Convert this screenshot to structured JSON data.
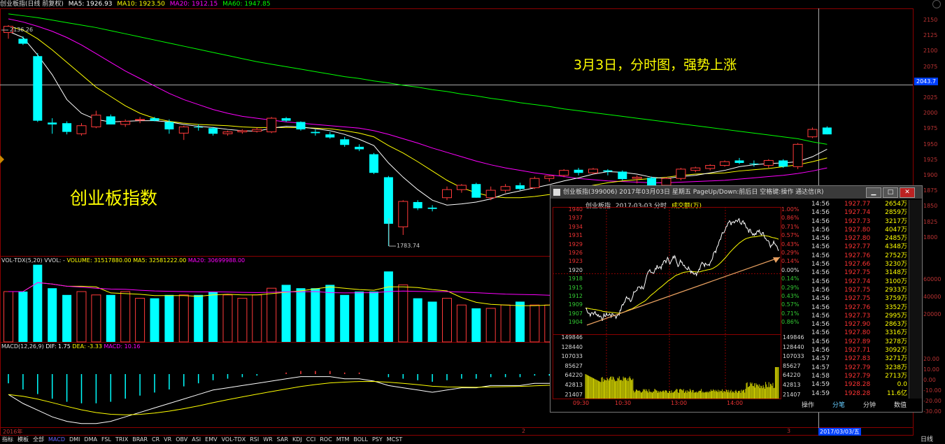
{
  "topbar": {
    "title": "创业板指(日线 前复权)",
    "ma5": "MA5: 1926.93",
    "ma10": "MA10: 1923.50",
    "ma20": "MA20: 1912.15",
    "ma60": "MA60: 1947.85"
  },
  "colors": {
    "up": "#ff3a3a",
    "down": "#00ffff",
    "ma5": "#ffffff",
    "ma10": "#ffff00",
    "ma20": "#ff00ff",
    "ma60": "#00ff00"
  },
  "price_axis": [
    "2150",
    "2125",
    "2100",
    "2075",
    "2050",
    "2025",
    "2000",
    "1975",
    "1950",
    "1925",
    "1900",
    "1875",
    "1850",
    "1825",
    "1800"
  ],
  "crosshair_price": "2043.7",
  "annotations": {
    "high_label": "2136.26",
    "low_label": "1783.74",
    "title_note": "3月3日，分时图，强势上涨",
    "index_label": "创业板指数"
  },
  "volume_header": {
    "name": "VOL-TDX(5,20) VVOL: -",
    "volume": "VOLUME: 31517880.00",
    "ma5": "MA5: 32581222.00",
    "ma20": "MA20: 30699988.00"
  },
  "macd_header": {
    "name": "MACD(12,26,9)",
    "dif": "DIF: 1.75",
    "dea": "DEA: -3.33",
    "macd": "MACD: 10.16"
  },
  "vol_axis": [
    "60000",
    "40000",
    "20000"
  ],
  "macd_axis": [
    "20.00",
    "10.00",
    "0.00",
    "-10.00",
    "-20.00",
    "-30.00"
  ],
  "date_axis": {
    "year": "2016年",
    "m2": "2",
    "m3": "3",
    "cursor_date": "2017/03/03/五"
  },
  "bottom_tabs": [
    "指标",
    "模板",
    "全部",
    "MACD",
    "DMI",
    "DMA",
    "FSL",
    "TRIX",
    "BRAR",
    "CR",
    "VR",
    "OBV",
    "ASI",
    "EMV",
    "VOL-TDX",
    "RSI",
    "WR",
    "SAR",
    "KDJ",
    "CCI",
    "ROC",
    "MTM",
    "BOLL",
    "PSY",
    "MCST"
  ],
  "bottom_right": "日线",
  "popup": {
    "title": "创业板指(399006) 2017年03月03日 星期五 PageUp/Down:前后日 空格键:操作 通达信(R)",
    "header_name": "创业板指",
    "header_date": "2017-03-03 分时",
    "header_vol": "成交额(万)",
    "left_prices": [
      "1940",
      "1937",
      "1934",
      "1931",
      "1929",
      "1926",
      "1923",
      "1920",
      "1918",
      "1915",
      "1912",
      "1909",
      "1907",
      "1904"
    ],
    "right_pcts": [
      "1.00%",
      "0.86%",
      "0.71%",
      "0.57%",
      "0.43%",
      "0.29%",
      "0.14%",
      "0.00%",
      "0.14%",
      "0.29%",
      "0.43%",
      "0.57%",
      "0.71%",
      "0.86%"
    ],
    "vol_left": [
      "149846",
      "128440",
      "107033",
      "85627",
      "64220",
      "42813",
      "21407"
    ],
    "vol_right": [
      "149846",
      "128440",
      "107033",
      "85627",
      "64220",
      "42813",
      "21407"
    ],
    "time_axis": [
      "09:30",
      "10:30",
      "13:00",
      "14:00"
    ],
    "ticks": [
      {
        "t": "14:56",
        "p": "1927.77",
        "v": "2654万"
      },
      {
        "t": "14:56",
        "p": "1927.74",
        "v": "2859万"
      },
      {
        "t": "14:56",
        "p": "1927.73",
        "v": "3217万"
      },
      {
        "t": "14:56",
        "p": "1927.80",
        "v": "4047万"
      },
      {
        "t": "14:56",
        "p": "1927.80",
        "v": "2485万"
      },
      {
        "t": "14:56",
        "p": "1927.77",
        "v": "4348万"
      },
      {
        "t": "14:56",
        "p": "1927.76",
        "v": "2752万"
      },
      {
        "t": "14:56",
        "p": "1927.66",
        "v": "3230万"
      },
      {
        "t": "14:56",
        "p": "1927.75",
        "v": "3148万"
      },
      {
        "t": "14:56",
        "p": "1927.74",
        "v": "3100万"
      },
      {
        "t": "14:56",
        "p": "1927.75",
        "v": "2933万"
      },
      {
        "t": "14:56",
        "p": "1927.75",
        "v": "3759万"
      },
      {
        "t": "14:56",
        "p": "1927.76",
        "v": "3352万"
      },
      {
        "t": "14:56",
        "p": "1927.73",
        "v": "2995万"
      },
      {
        "t": "14:56",
        "p": "1927.90",
        "v": "2863万"
      },
      {
        "t": "14:56",
        "p": "1927.80",
        "v": "3316万"
      },
      {
        "t": "14:56",
        "p": "1927.89",
        "v": "3278万"
      },
      {
        "t": "14:56",
        "p": "1927.71",
        "v": "3092万"
      },
      {
        "t": "14:57",
        "p": "1927.83",
        "v": "3271万"
      },
      {
        "t": "14:57",
        "p": "1927.79",
        "v": "3238万"
      },
      {
        "t": "14:58",
        "p": "1927.79",
        "v": "2713万"
      },
      {
        "t": "14:59",
        "p": "1928.28",
        "v": "0.0"
      },
      {
        "t": "14:59",
        "p": "1928.28",
        "v": "11.6亿"
      }
    ],
    "tabs": [
      "操作",
      "分笔",
      "分钟",
      "数值"
    ]
  },
  "candles": [
    {
      "o": 2128,
      "h": 2140,
      "l": 2118,
      "c": 2138
    },
    {
      "o": 2118,
      "h": 2122,
      "l": 2108,
      "c": 2110
    },
    {
      "o": 2090,
      "h": 2095,
      "l": 1984,
      "c": 1986
    },
    {
      "o": 1983,
      "h": 1990,
      "l": 1965,
      "c": 1980
    },
    {
      "o": 1982,
      "h": 1985,
      "l": 1964,
      "c": 1968
    },
    {
      "o": 1965,
      "h": 1982,
      "l": 1962,
      "c": 1978
    },
    {
      "o": 1976,
      "h": 2002,
      "l": 1974,
      "c": 1995
    },
    {
      "o": 1993,
      "h": 1996,
      "l": 1980,
      "c": 1980
    },
    {
      "o": 1980,
      "h": 1988,
      "l": 1976,
      "c": 1985
    },
    {
      "o": 1987,
      "h": 1992,
      "l": 1982,
      "c": 1988
    },
    {
      "o": 1990,
      "h": 1992,
      "l": 1985,
      "c": 1986
    },
    {
      "o": 1984,
      "h": 1988,
      "l": 1965,
      "c": 1972
    },
    {
      "o": 1966,
      "h": 1978,
      "l": 1955,
      "c": 1976
    },
    {
      "o": 1976,
      "h": 1980,
      "l": 1970,
      "c": 1975
    },
    {
      "o": 1974,
      "h": 1976,
      "l": 1962,
      "c": 1965
    },
    {
      "o": 1965,
      "h": 1970,
      "l": 1962,
      "c": 1968
    },
    {
      "o": 1968,
      "h": 1972,
      "l": 1965,
      "c": 1970
    },
    {
      "o": 1969,
      "h": 1975,
      "l": 1967,
      "c": 1972
    },
    {
      "o": 1968,
      "h": 1992,
      "l": 1966,
      "c": 1990
    },
    {
      "o": 1990,
      "h": 1992,
      "l": 1984,
      "c": 1986
    },
    {
      "o": 1984,
      "h": 1985,
      "l": 1970,
      "c": 1972
    },
    {
      "o": 1968,
      "h": 1972,
      "l": 1962,
      "c": 1966
    },
    {
      "o": 1964,
      "h": 1968,
      "l": 1957,
      "c": 1959
    },
    {
      "o": 1956,
      "h": 1960,
      "l": 1944,
      "c": 1947
    },
    {
      "o": 1944,
      "h": 1948,
      "l": 1937,
      "c": 1940
    },
    {
      "o": 1932,
      "h": 1934,
      "l": 1900,
      "c": 1902
    },
    {
      "o": 1895,
      "h": 1897,
      "l": 1784,
      "c": 1820
    },
    {
      "o": 1815,
      "h": 1858,
      "l": 1802,
      "c": 1856
    },
    {
      "o": 1855,
      "h": 1858,
      "l": 1842,
      "c": 1845
    },
    {
      "o": 1846,
      "h": 1850,
      "l": 1840,
      "c": 1844
    },
    {
      "o": 1862,
      "h": 1880,
      "l": 1858,
      "c": 1875
    },
    {
      "o": 1875,
      "h": 1884,
      "l": 1870,
      "c": 1882
    },
    {
      "o": 1884,
      "h": 1886,
      "l": 1862,
      "c": 1862
    },
    {
      "o": 1862,
      "h": 1880,
      "l": 1858,
      "c": 1874
    },
    {
      "o": 1874,
      "h": 1884,
      "l": 1870,
      "c": 1880
    },
    {
      "o": 1882,
      "h": 1886,
      "l": 1874,
      "c": 1876
    },
    {
      "o": 1878,
      "h": 1896,
      "l": 1876,
      "c": 1893
    },
    {
      "o": 1893,
      "h": 1898,
      "l": 1888,
      "c": 1897
    },
    {
      "o": 1898,
      "h": 1908,
      "l": 1895,
      "c": 1906
    },
    {
      "o": 1907,
      "h": 1910,
      "l": 1898,
      "c": 1902
    },
    {
      "o": 1902,
      "h": 1910,
      "l": 1900,
      "c": 1908
    },
    {
      "o": 1906,
      "h": 1908,
      "l": 1898,
      "c": 1904
    },
    {
      "o": 1904,
      "h": 1906,
      "l": 1890,
      "c": 1892
    },
    {
      "o": 1893,
      "h": 1898,
      "l": 1885,
      "c": 1895
    },
    {
      "o": 1894,
      "h": 1896,
      "l": 1878,
      "c": 1880
    },
    {
      "o": 1882,
      "h": 1895,
      "l": 1880,
      "c": 1893
    },
    {
      "o": 1893,
      "h": 1910,
      "l": 1890,
      "c": 1908
    },
    {
      "o": 1906,
      "h": 1912,
      "l": 1903,
      "c": 1910
    },
    {
      "o": 1909,
      "h": 1916,
      "l": 1906,
      "c": 1914
    },
    {
      "o": 1914,
      "h": 1922,
      "l": 1912,
      "c": 1920
    },
    {
      "o": 1922,
      "h": 1926,
      "l": 1916,
      "c": 1918
    },
    {
      "o": 1917,
      "h": 1922,
      "l": 1912,
      "c": 1916
    },
    {
      "o": 1914,
      "h": 1924,
      "l": 1910,
      "c": 1922
    },
    {
      "o": 1922,
      "h": 1924,
      "l": 1910,
      "c": 1912
    },
    {
      "o": 1912,
      "h": 1950,
      "l": 1908,
      "c": 1948
    },
    {
      "o": 1960,
      "h": 1975,
      "l": 1958,
      "c": 1972
    },
    {
      "o": 1975,
      "h": 1977,
      "l": 1964,
      "c": 1964
    }
  ],
  "volumes": [
    15,
    15,
    23,
    16,
    14,
    15,
    14,
    14,
    15,
    13,
    13,
    14,
    14,
    14,
    15,
    14,
    13,
    14,
    16,
    17,
    16,
    16,
    17,
    14,
    15,
    15,
    21,
    17,
    13,
    12,
    13,
    11,
    10,
    10,
    11,
    12,
    11,
    11,
    12,
    12,
    11,
    11,
    10,
    10,
    9,
    9,
    10,
    11,
    11,
    12,
    12,
    12,
    12,
    12,
    13,
    14,
    16
  ],
  "ma_lines": {
    "ma5": [
      2130,
      2120,
      2092,
      2060,
      2020,
      1998,
      1988,
      1984,
      1985,
      1986,
      1986,
      1984,
      1980,
      1977,
      1975,
      1972,
      1970,
      1969,
      1974,
      1977,
      1976,
      1973,
      1970,
      1964,
      1956,
      1946,
      1918,
      1895,
      1875,
      1858,
      1850,
      1852,
      1855,
      1860,
      1868,
      1873,
      1878,
      1883,
      1889,
      1894,
      1900,
      1904,
      1903,
      1900,
      1895,
      1893,
      1896,
      1898,
      1902,
      1906,
      1912,
      1915,
      1917,
      1918,
      1920,
      1928,
      1940
    ],
    "ma10": [
      2138,
      2132,
      2118,
      2100,
      2080,
      2060,
      2040,
      2025,
      2010,
      1998,
      1990,
      1985,
      1982,
      1980,
      1979,
      1978,
      1976,
      1975,
      1975,
      1975,
      1975,
      1974,
      1973,
      1970,
      1966,
      1960,
      1946,
      1934,
      1920,
      1905,
      1890,
      1878,
      1870,
      1864,
      1862,
      1862,
      1864,
      1867,
      1872,
      1877,
      1882,
      1886,
      1889,
      1891,
      1893,
      1895,
      1898,
      1900,
      1901,
      1902,
      1905,
      1907,
      1909,
      1912,
      1915,
      1920,
      1926
    ],
    "ma20": [
      2150,
      2145,
      2138,
      2130,
      2120,
      2108,
      2094,
      2080,
      2066,
      2054,
      2042,
      2030,
      2020,
      2012,
      2004,
      1998,
      1993,
      1990,
      1987,
      1984,
      1982,
      1980,
      1978,
      1976,
      1974,
      1970,
      1964,
      1957,
      1950,
      1942,
      1935,
      1928,
      1921,
      1915,
      1910,
      1906,
      1902,
      1899,
      1896,
      1893,
      1891,
      1889,
      1888,
      1887,
      1886,
      1886,
      1887,
      1888,
      1889,
      1890,
      1892,
      1894,
      1896,
      1898,
      1901,
      1905,
      1910
    ],
    "ma60": [
      2158,
      2155,
      2152,
      2148,
      2144,
      2140,
      2136,
      2131,
      2126,
      2121,
      2116,
      2111,
      2106,
      2101,
      2096,
      2091,
      2086,
      2081,
      2077,
      2073,
      2069,
      2065,
      2061,
      2057,
      2054,
      2050,
      2047,
      2043,
      2040,
      2036,
      2033,
      2029,
      2026,
      2022,
      2019,
      2015,
      2012,
      2009,
      2005,
      2002,
      1999,
      1996,
      1993,
      1990,
      1987,
      1984,
      1981,
      1978,
      1975,
      1972,
      1969,
      1966,
      1963,
      1960,
      1957,
      1952,
      1948
    ]
  },
  "macd_hist": [
    -6,
    -10,
    -13,
    -16,
    -18,
    -19,
    -19,
    -18,
    -16,
    -14,
    -12,
    -10,
    -8,
    -6,
    -4,
    -3,
    -2,
    -1,
    0,
    1,
    2,
    2,
    2,
    1,
    1,
    0,
    -2,
    -3,
    -4,
    -5,
    -4,
    -3,
    -3,
    -2,
    -2,
    -2,
    -1,
    -1,
    0,
    1,
    1,
    2,
    2,
    1,
    1,
    1,
    2,
    3,
    3,
    4,
    4,
    5,
    5,
    5,
    6,
    8,
    10
  ]
}
